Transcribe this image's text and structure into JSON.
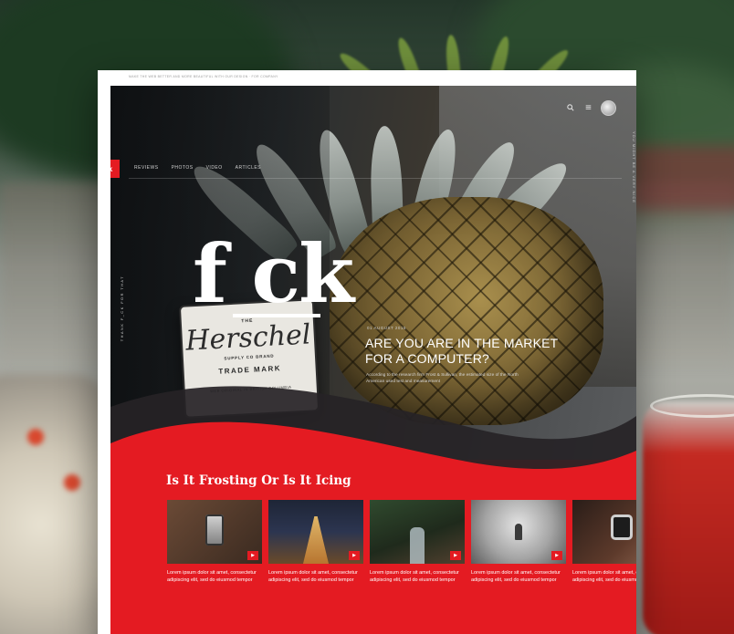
{
  "mockup": {
    "top_line": "MAKE THE WEB BETTER AND MORE BEAUTIFUL WITH OUR DESIGN · FOR COMPANY",
    "logo": "k",
    "nav": [
      "REVIEWS",
      "PHOTOS",
      "VIDEO",
      "ARTICLES"
    ],
    "side_right_text": "YOU MIGHT BE A VERY NICE",
    "side_left_text": "THANK F_CK FOR THAT",
    "tag": {
      "small": "THE",
      "brand": "Herschel",
      "line": "SUPPLY CO BRAND",
      "mark": "TRADE MARK",
      "foot": "WEB ORIGINAL IN BRITISH COLUMBIA"
    },
    "headline": "f ck",
    "post": {
      "date": "01 AUGUST 2015",
      "title": "ARE YOU ARE IN THE MARKET FOR A COMPUTER?",
      "excerpt": "According to the research firm Frost & Sullivan, the estimated size of the North American used test and measurement"
    },
    "section_title": "Is It Frosting Or Is It Icing",
    "cards": [
      {
        "text": "Lorem ipsum dolor sit amet, consectetur adipiscing elit, sed do eiusmod tempor",
        "badge": "▶"
      },
      {
        "text": "Lorem ipsum dolor sit amet, consectetur adipiscing elit, sed do eiusmod tempor",
        "badge": "▶"
      },
      {
        "text": "Lorem ipsum dolor sit amet, consectetur adipiscing elit, sed do eiusmod tempor",
        "badge": "▶"
      },
      {
        "text": "Lorem ipsum dolor sit amet, consectetur adipiscing elit, sed do eiusmod tempor",
        "badge": "▶"
      },
      {
        "text": "Lorem ipsum dolor sit amet, consectetur adipiscing elit, sed do eiusmod tempor",
        "badge": "▶"
      }
    ]
  },
  "icons": {
    "search": "search-icon",
    "menu": "menu-icon",
    "avatar": "avatar"
  },
  "colors": {
    "accent": "#e41b22",
    "dark_band": "#262326",
    "paper": "#ffffff"
  }
}
